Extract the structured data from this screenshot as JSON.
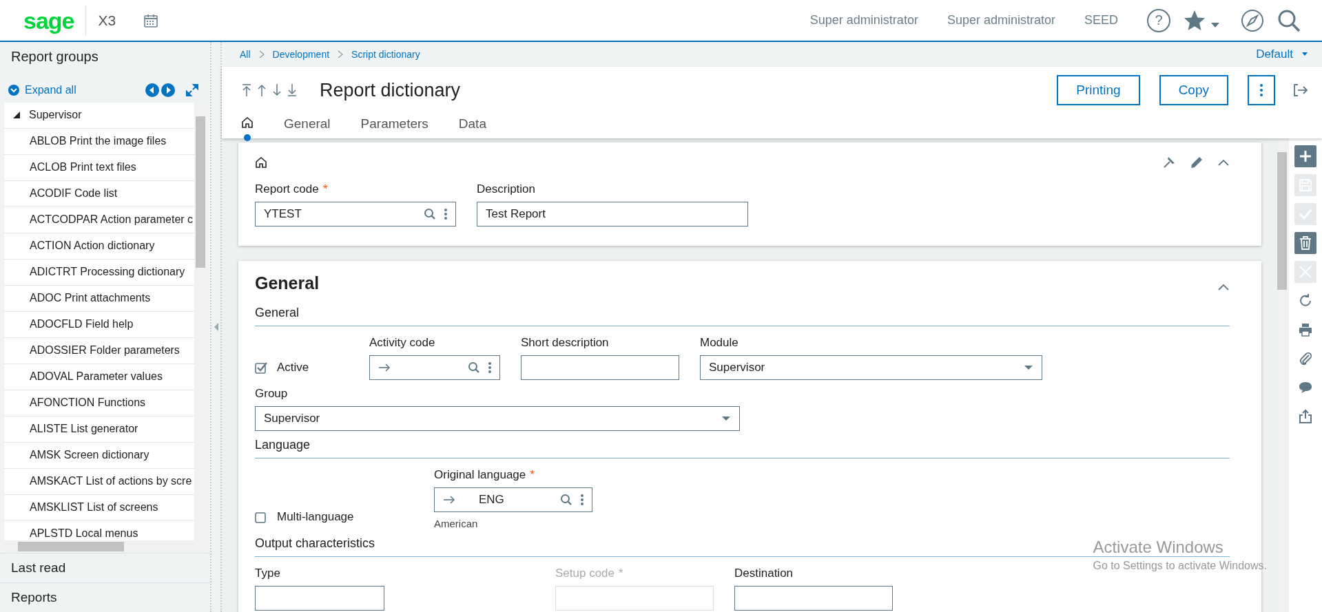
{
  "header": {
    "logo": "sage",
    "product": "X3",
    "user": "Super administrator",
    "role": "Super administrator",
    "folder": "SEED",
    "help": "?"
  },
  "sidebar": {
    "title": "Report groups",
    "expand_all": "Expand all",
    "tree": [
      {
        "label": "Supervisor",
        "expanded": true,
        "children": [
          {
            "label": "ABLOB Print the image files"
          },
          {
            "label": "ACLOB Print text files"
          },
          {
            "label": "ACODIF Code list"
          },
          {
            "label": "ACTCODPAR Action parameter c"
          },
          {
            "label": "ACTION Action dictionary"
          },
          {
            "label": "ADICTRT Processing dictionary"
          },
          {
            "label": "ADOC Print attachments"
          },
          {
            "label": "ADOCFLD Field help"
          },
          {
            "label": "ADOSSIER Folder parameters"
          },
          {
            "label": "ADOVAL Parameter values"
          },
          {
            "label": "AFONCTION Functions"
          },
          {
            "label": "ALISTE List generator"
          },
          {
            "label": "AMSK Screen dictionary"
          },
          {
            "label": "AMSKACT List of actions by scre"
          },
          {
            "label": "AMSKLIST List of screens"
          },
          {
            "label": "APLSTD Local menus"
          }
        ]
      }
    ],
    "sections": [
      "Last read",
      "Reports"
    ]
  },
  "breadcrumb": [
    "All",
    "Development",
    "Script dictionary"
  ],
  "view": "Default",
  "page": {
    "title": "Report dictionary",
    "buttons": [
      "Printing",
      "Copy"
    ],
    "tabs": [
      {
        "kind": "home",
        "selected": true
      },
      {
        "kind": "text",
        "label": "General",
        "selected": false
      },
      {
        "kind": "text",
        "label": "Parameters",
        "selected": false
      },
      {
        "kind": "text",
        "label": "Data",
        "selected": false
      }
    ]
  },
  "header_card": {
    "fields": [
      {
        "kind": "lookup",
        "label": "Report code",
        "required_mark": "*",
        "value": "YTEST"
      },
      {
        "kind": "text",
        "label": "Description",
        "value": "Test Report"
      }
    ]
  },
  "general_card": {
    "title": "General",
    "sections": [
      {
        "title": "General",
        "rows": [
          [
            {
              "kind": "checkbox",
              "label": "Active",
              "checked": true
            },
            {
              "kind": "lookup",
              "label": "Activity code",
              "arrow": true
            },
            {
              "kind": "text",
              "label": "Short description"
            },
            {
              "kind": "select",
              "label": "Module",
              "value": "Supervisor"
            }
          ],
          [
            {
              "kind": "select",
              "label": "Group",
              "value": "Supervisor"
            }
          ]
        ]
      },
      {
        "title": "Language",
        "rows": [
          [
            {
              "kind": "checkbox",
              "label": "Multi-language",
              "checked": false
            },
            {
              "kind": "lookup",
              "label": "Original language",
              "required_mark": "*",
              "arrow": true,
              "value": "ENG",
              "hint": "American"
            }
          ]
        ]
      },
      {
        "title": "Output characteristics",
        "rows": [
          [
            {
              "kind": "text",
              "label": "Type"
            },
            {
              "kind": "text",
              "label": "Setup code",
              "required_mark": "*",
              "disabled": true
            },
            {
              "kind": "text",
              "label": "Destination"
            }
          ]
        ]
      }
    ]
  },
  "actions": [
    {
      "kind": "add",
      "disabled": false
    },
    {
      "kind": "save",
      "disabled": true
    },
    {
      "kind": "check",
      "disabled": true
    },
    {
      "kind": "delete",
      "disabled": false
    },
    {
      "kind": "cancel",
      "disabled": true
    },
    {
      "kind": "refresh",
      "disabled": false
    },
    {
      "kind": "print",
      "disabled": false
    },
    {
      "kind": "attach",
      "disabled": false
    },
    {
      "kind": "comment",
      "disabled": false
    },
    {
      "kind": "share",
      "disabled": false
    }
  ],
  "windows_notice": {
    "title": "Activate Windows",
    "text": "Go to Settings to activate Windows."
  }
}
